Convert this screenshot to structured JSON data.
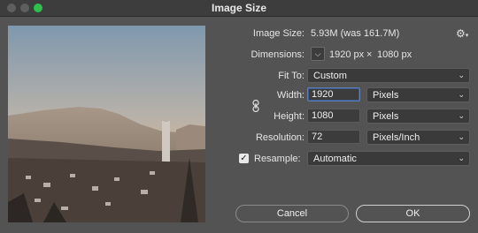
{
  "window": {
    "title": "Image Size"
  },
  "image_size": {
    "label": "Image Size:",
    "value": "5.93M (was 161.7M)"
  },
  "dimensions": {
    "label": "Dimensions:",
    "width": "1920 px",
    "times": "×",
    "height": "1080 px"
  },
  "fit_to": {
    "label": "Fit To:",
    "value": "Custom"
  },
  "width": {
    "label": "Width:",
    "value": "1920",
    "unit": "Pixels"
  },
  "height": {
    "label": "Height:",
    "value": "1080",
    "unit": "Pixels"
  },
  "resolution": {
    "label": "Resolution:",
    "value": "72",
    "unit": "Pixels/Inch"
  },
  "resample": {
    "label": "Resample:",
    "checked": true,
    "value": "Automatic"
  },
  "buttons": {
    "cancel": "Cancel",
    "ok": "OK"
  },
  "icons": {
    "gear": "gear-icon",
    "link": "link-icon",
    "chevron": "chevron-down-icon",
    "check": "checkmark-icon"
  },
  "colors": {
    "background": "#535353",
    "titlebar": "#3d3d3d",
    "maximize": "#2ec04a",
    "focus": "#5f7fb3"
  }
}
